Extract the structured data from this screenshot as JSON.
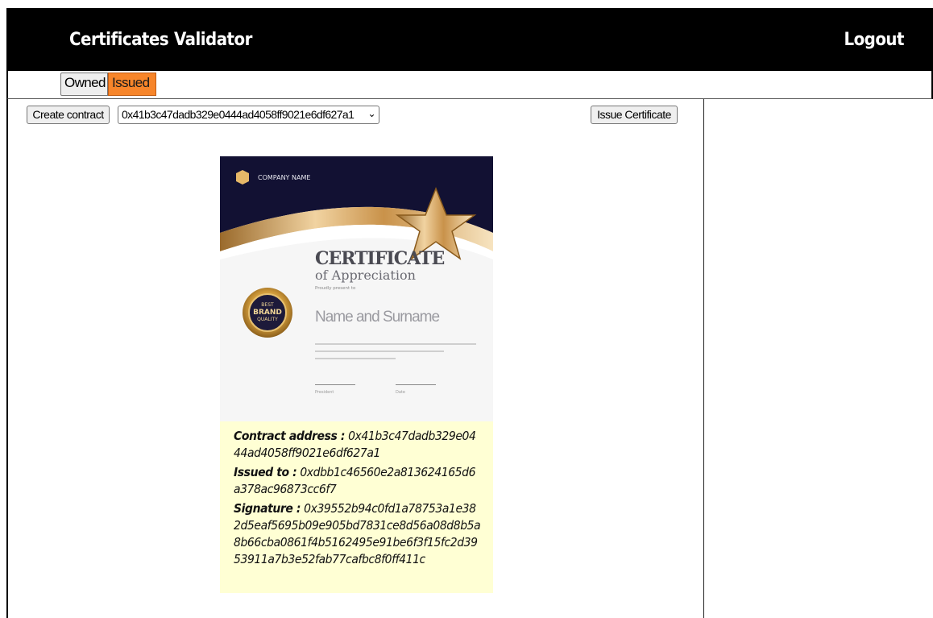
{
  "nav": {
    "certificates": "Certificates",
    "validator": "Validator",
    "logout": "Logout"
  },
  "tabs": {
    "owned": "Owned",
    "issued": "Issued",
    "active_color": "#f7852a"
  },
  "toolbar": {
    "create_contract": "Create contract",
    "selected_contract": "0x41b3c47dadb329e0444ad4058ff9021e6df627a1",
    "issue_certificate": "Issue Certificate"
  },
  "certificate": {
    "company": "COMPANY NAME",
    "title": "CERTIFICATE",
    "subtitle": "of Appreciation",
    "presented": "Proudly present to",
    "recipient": "Name and Surname",
    "badge_top": "BEST",
    "badge_main": "BRAND",
    "badge_bottom": "QUALITY",
    "sign_left": "President",
    "sign_right": "Date"
  },
  "details": {
    "contract_label": "Contract address :",
    "contract_value": "0x41b3c47dadb329e0444ad4058ff9021e6df627a1",
    "issued_label": "Issued to :",
    "issued_value": "0xdbb1c46560e2a813624165d6a378ac96873cc6f7",
    "signature_label": "Signature :",
    "signature_value": "0x39552b94c0fd1a78753a1e382d5eaf5695b09e905bd7831ce8d56a08d8b5a8b66cba0861f4b5162495e91be6f3f15fc2d3953911a7b3e52fab77cafbc8f0ff411c"
  }
}
